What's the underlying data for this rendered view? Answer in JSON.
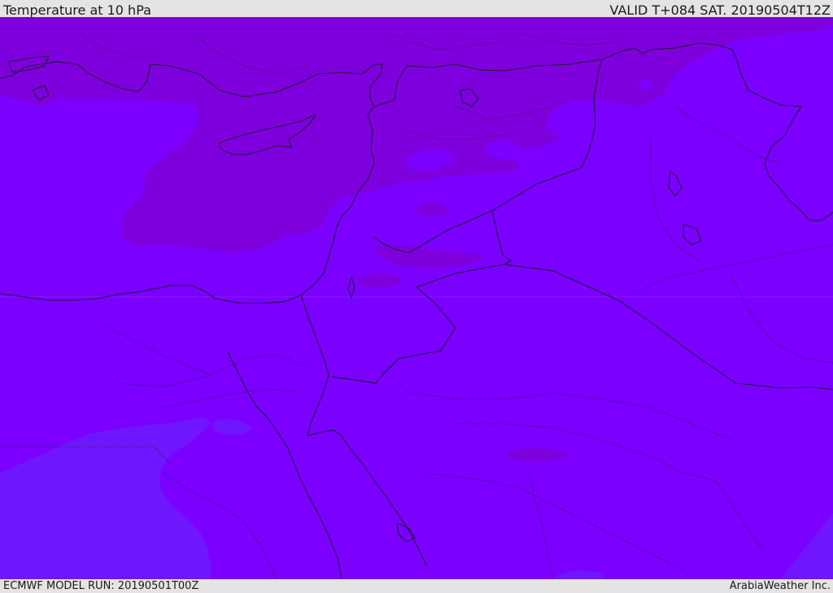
{
  "header": {
    "title": "Temperature at 10 hPa",
    "valid": "VALID T+084 SAT. 20190504T12Z"
  },
  "footer": {
    "model_run": "ECMWF MODEL RUN: 20190501T00Z",
    "credit": "ArabiaWeather Inc."
  },
  "map": {
    "colors": {
      "base_field": "#7b00ff",
      "warm_field": "#7e00dc",
      "cool_field": "#6e17ff",
      "land_lines": "#1a1a2e"
    }
  }
}
